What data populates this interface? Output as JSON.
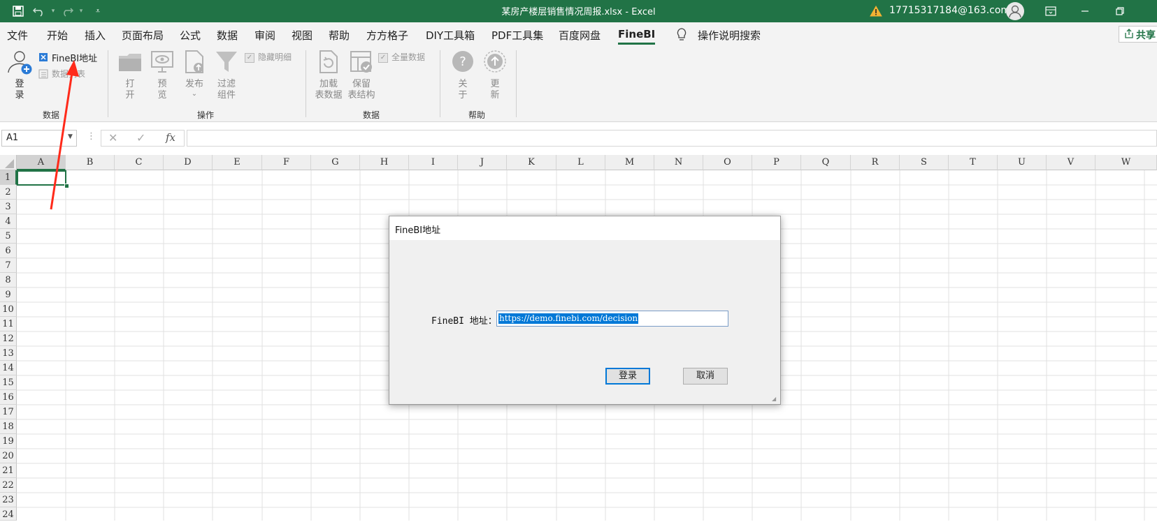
{
  "titlebar": {
    "title": "某房产楼层销售情况周报.xlsx  -  Excel",
    "account": "17715317184@163.com",
    "icons": [
      "save-icon",
      "undo-icon",
      "redo-icon",
      "customize-icon",
      "warning-icon",
      "avatar",
      "ribbon-display-icon",
      "minimize-icon",
      "restore-icon",
      "close-icon"
    ]
  },
  "menu": {
    "items": [
      "文件",
      "开始",
      "插入",
      "页面布局",
      "公式",
      "数据",
      "审阅",
      "视图",
      "帮助",
      "方方格子",
      "DIY工具箱",
      "PDF工具集",
      "百度网盘",
      "FineBI"
    ],
    "active": "FineBI",
    "search": "操作说明搜索",
    "share": "共享"
  },
  "ribbon": {
    "login": "登\n录",
    "finebi_addr": "FineBI地址",
    "data_list": "数据列表",
    "group_data": "数据",
    "open": "打\n开",
    "preview": "预\n览",
    "publish": "发布",
    "filter": "过滤\n组件",
    "hide_detail": "隐藏明细",
    "group_ops": "操作",
    "load": "加载\n表数据",
    "keep": "保留\n表结构",
    "all_data": "全量数据",
    "group_data2": "数据",
    "about": "关\n于",
    "update": "更\n新",
    "group_help": "帮助"
  },
  "formula": {
    "namebox": "A1",
    "fx": "fx",
    "value": ""
  },
  "grid": {
    "columns": [
      "A",
      "B",
      "C",
      "D",
      "E",
      "F",
      "G",
      "H",
      "I",
      "J",
      "K",
      "L",
      "M",
      "N",
      "O",
      "P",
      "Q",
      "R",
      "S",
      "T",
      "U",
      "V",
      "W"
    ],
    "rows": [
      "1",
      "2",
      "3",
      "4",
      "5",
      "6",
      "7",
      "8",
      "9",
      "10",
      "11",
      "12",
      "13",
      "14",
      "15",
      "16",
      "17",
      "18",
      "19",
      "20",
      "21",
      "22",
      "23",
      "24"
    ],
    "selected": "A1"
  },
  "dialog": {
    "title": "FineBI地址",
    "label": "FineBI 地址：",
    "value": "https://demo.finebi.com/decision",
    "login": "登录",
    "cancel": "取消"
  },
  "colors": {
    "excel_green": "#217346",
    "annotation_arrow": "#ff2a1a",
    "selection_blue": "#0078d7"
  }
}
